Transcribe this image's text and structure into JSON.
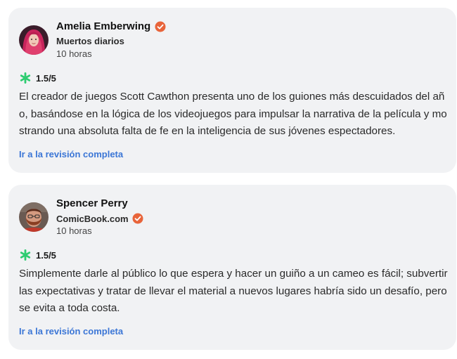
{
  "reviews": [
    {
      "author": "Amelia Emberwing",
      "publication": "Muertos diarios",
      "time": "10 horas",
      "score": "1.5/5",
      "quote": "El creador de juegos Scott Cawthon presenta uno de los guiones más descuidados del año, basándose en la lógica de los videojuegos para impulsar la narrativa de la película y mostrando una absoluta falta de fe en la inteligencia de sus jóvenes espectadores.",
      "link": "Ir a la revisión completa",
      "avatar_icon": "user-avatar-red-hair",
      "author_verified": true,
      "publication_verified": false
    },
    {
      "author": "Spencer Perry",
      "publication": "ComicBook.com",
      "time": "10 horas",
      "score": "1.5/5",
      "quote": "Simplemente darle al público lo que espera y hacer un guiño a un cameo es fácil; subvertir las expectativas y tratar de llevar el material a nuevos lugares habría sido un desafío, pero se evita a toda costa.",
      "link": "Ir a la revisión completa",
      "avatar_icon": "user-avatar-bearded",
      "author_verified": false,
      "publication_verified": true
    }
  ],
  "colors": {
    "card_background": "#f1f2f4",
    "link": "#3b76d6",
    "verified_badge": "#e8643a",
    "rotten_splat": "#2ecc71"
  },
  "icons": {
    "verified": "verified-check-badge-icon",
    "rating": "green-splat-icon"
  }
}
